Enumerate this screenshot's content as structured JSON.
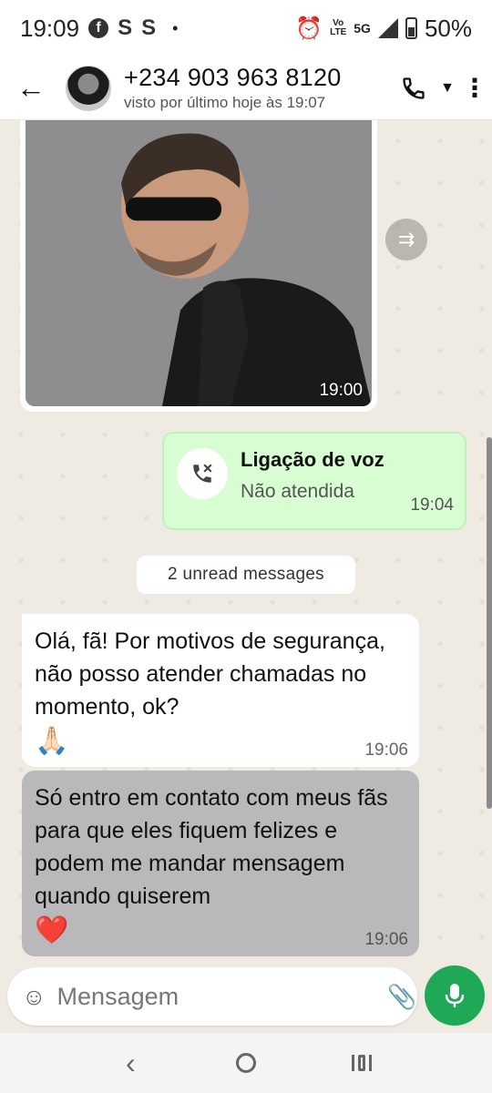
{
  "status_bar": {
    "time": "19:09",
    "app_icons": [
      "facebook-icon",
      "s-icon",
      "s-icon"
    ],
    "s_label": "S",
    "dot": "•",
    "volte_top": "Vo",
    "volte_bottom": "LTE",
    "network": "5G",
    "battery": "50%"
  },
  "header": {
    "contact_name": "+234 903 963 8120",
    "last_seen": "visto por último hoje às 19:07"
  },
  "messages": {
    "image_time": "19:00",
    "call": {
      "title": "Ligação de voz",
      "subtitle": "Não atendida",
      "time": "19:04"
    },
    "unread_label": "2 unread messages",
    "msg1": {
      "text": "Olá, fã! Por motivos de segurança, não posso atender chamadas no momento, ok?",
      "emoji": "🙏🏻",
      "time": "19:06"
    },
    "msg2": {
      "text": "Só entro em contato com meus fãs para que eles fiquem felizes e podem me mandar mensagem quando quiserem",
      "emoji": "❤️",
      "time": "19:06"
    }
  },
  "composer": {
    "placeholder": "Mensagem"
  },
  "colors": {
    "accent": "#1fa856",
    "outgoing_bubble": "#d9fdd3",
    "chat_bg": "#efeae2"
  }
}
